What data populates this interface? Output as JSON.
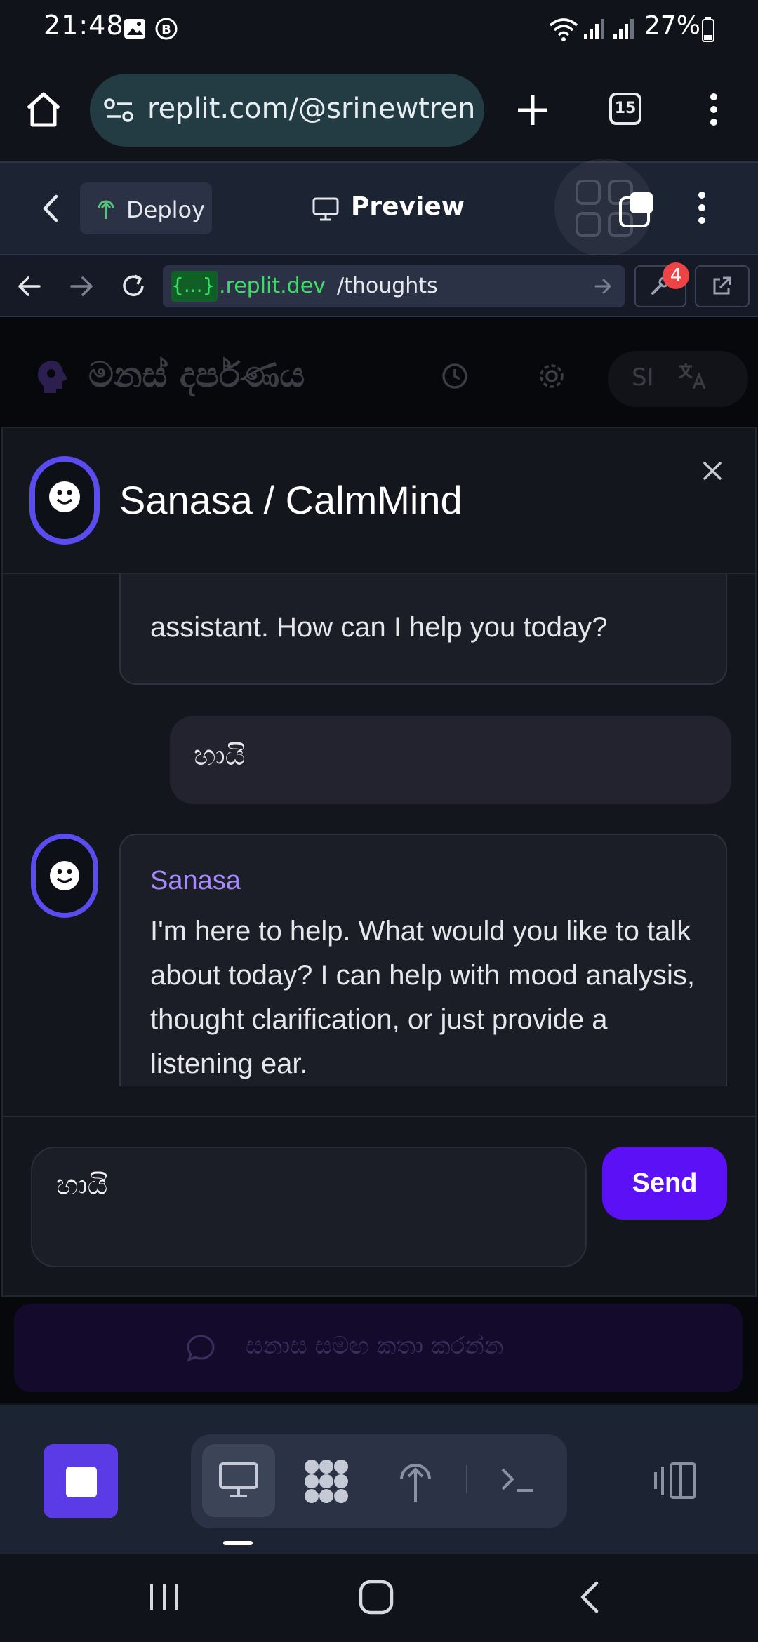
{
  "status_bar": {
    "time": "21:48",
    "battery": "27%",
    "icons": [
      "image-icon",
      "b-icon",
      "wifi-icon",
      "signal-icon",
      "signal-icon",
      "battery-icon"
    ]
  },
  "browser": {
    "url": "replit.com/@srinewtren",
    "tab_count": "15"
  },
  "replit_header": {
    "deploy_label": "Deploy",
    "preview_label": "Preview"
  },
  "webview": {
    "host_badge": "{...}",
    "host": ".replit.dev",
    "path": "/thoughts",
    "notification_count": "4"
  },
  "app": {
    "title": "මනස් දර්පණය",
    "language_code": "SI",
    "chat_launcher_label": "සනාස සමඟ කතා කරන්න"
  },
  "chat_modal": {
    "title": "Sanasa / CalmMind",
    "messages": [
      {
        "role": "assistant",
        "text": "assistant. How can I help you today?"
      },
      {
        "role": "user",
        "text": "හායි"
      },
      {
        "role": "assistant",
        "sender": "Sanasa",
        "text": "I'm here to help. What would you like to talk about today? I can help with mood analysis, thought clarification, or just provide a listening ear."
      }
    ],
    "input_value": "හායි",
    "send_label": "Send"
  },
  "colors": {
    "accent": "#5b10f5",
    "sender_name": "#a78bfa",
    "avatar_ring": "#5b4cf0",
    "host_text": "#3ddc66",
    "badge": "#ef4444"
  }
}
